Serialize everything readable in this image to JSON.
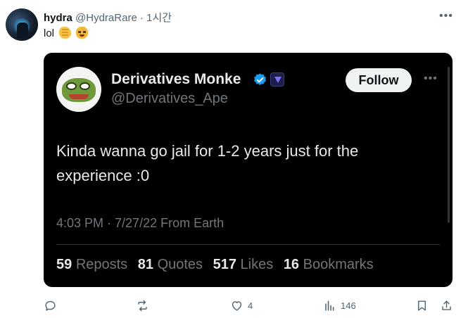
{
  "post": {
    "author_name": "hydra",
    "author_handle": "@HydraRare",
    "separator": "·",
    "time": "1시간",
    "text": "lol",
    "emojis": [
      "clapping-hands-emoji",
      "laughing-cat-emoji"
    ]
  },
  "quoted": {
    "display_name": "Derivatives Monke",
    "handle": "@Derivatives_Ape",
    "follow_label": "Follow",
    "body": "Kinda wanna go jail for 1-2 years just for the experience :0",
    "meta": "4:03 PM · 7/27/22 From Earth",
    "stats": [
      {
        "value": "59",
        "label": "Reposts"
      },
      {
        "value": "81",
        "label": "Quotes"
      },
      {
        "value": "517",
        "label": "Likes"
      },
      {
        "value": "16",
        "label": "Bookmarks"
      }
    ]
  },
  "actions": {
    "reply_icon": "reply-icon",
    "repost_icon": "repost-icon",
    "like_icon": "heart-icon",
    "like_count": "4",
    "views_icon": "views-icon",
    "views_count": "146",
    "bookmark_icon": "bookmark-icon",
    "share_icon": "share-icon"
  },
  "colors": {
    "verified": "#1d9bf0",
    "card_bg": "#000000",
    "muted": "#536471"
  }
}
